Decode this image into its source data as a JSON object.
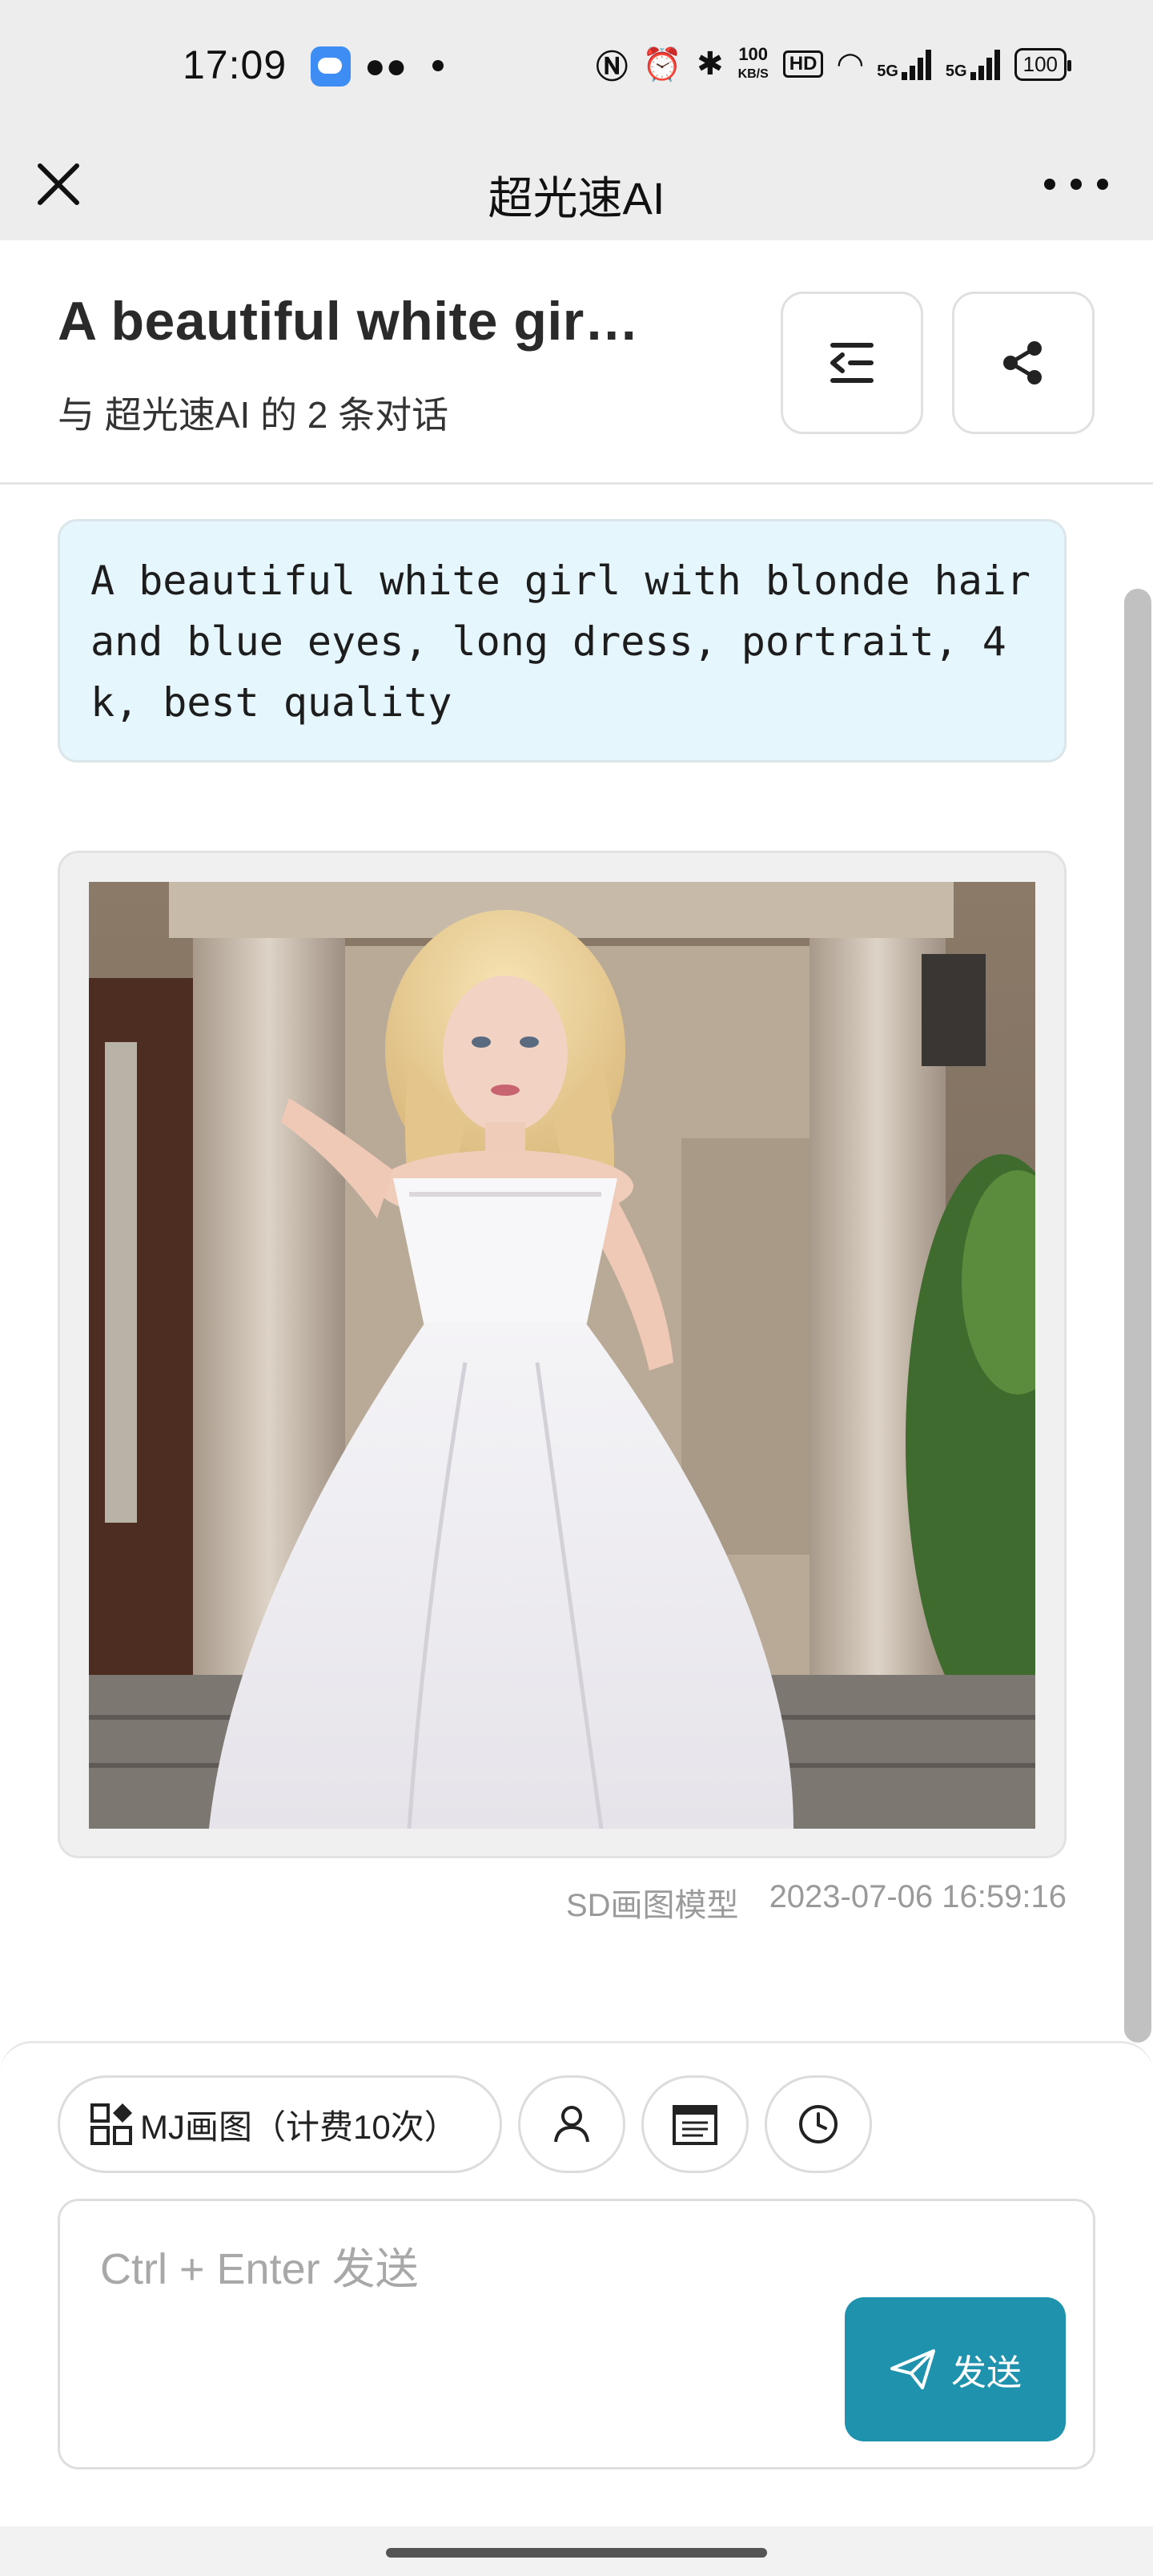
{
  "status_bar": {
    "time": "17:09",
    "net_speed_top": "100",
    "net_speed_unit": "KB/S",
    "hd_badge": "HD",
    "signal1_label": "5G",
    "signal2_label": "5G",
    "battery": "100"
  },
  "nav": {
    "title": "超光速AI"
  },
  "chat_header": {
    "title": "A beautiful white gir…",
    "subtitle": "与 超光速AI 的 2 条对话"
  },
  "messages": {
    "prompt_text": "A beautiful white girl with blonde hair and blue eyes, long dress, portrait, 4k, best quality",
    "model_label": "SD画图模型",
    "timestamp": "2023-07-06 16:59:16"
  },
  "composer": {
    "mode_label": "MJ画图（计费10次）",
    "input_placeholder": "Ctrl + Enter 发送",
    "send_label": "发送"
  },
  "colors": {
    "accent": "#1f93ad",
    "prompt_bg": "#e6f6fd",
    "nav_bg": "#ededed"
  },
  "icons": [
    "close-icon",
    "more-icon",
    "menu-indent-icon",
    "share-icon",
    "grid-icon",
    "user-icon",
    "template-icon",
    "history-icon",
    "send-icon"
  ]
}
